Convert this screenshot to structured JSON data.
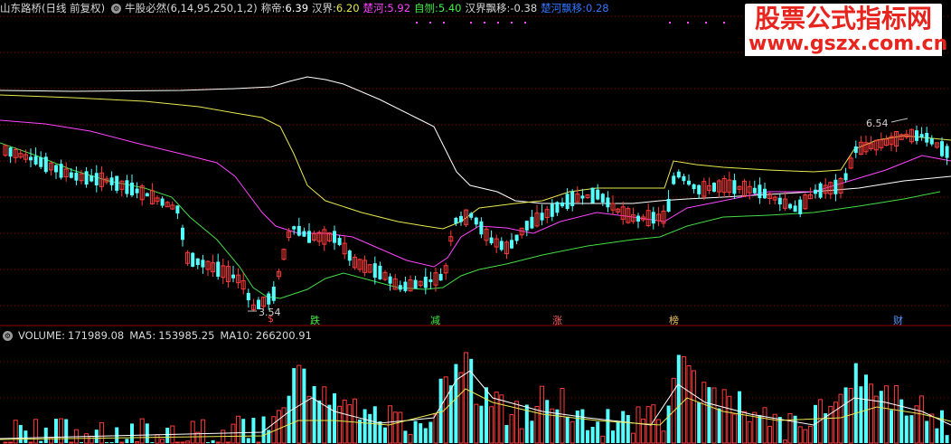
{
  "colors": {
    "up": "#ff3b3b",
    "down": "#54ffff",
    "ma_white": "#ffffff",
    "ma_yellow": "#e8e850",
    "ma_purple": "#ff44ff",
    "ma_green": "#44dd44",
    "grid": "#8b0000",
    "label_purple": "#ff44ff",
    "label_green": "#44ee44",
    "label_blue": "#3377ff"
  },
  "header": {
    "stock_name": "山东路桥(日线 前复权)",
    "indicator_name": "牛股必然(6,14,95,250,1,2)",
    "chendi_label": "称帝:",
    "chendi_value": "6.39",
    "hanjie_label": "汉界:",
    "hanjie_value": "6.20",
    "chuhe_label": "楚河:",
    "chuhe_value": "5.92",
    "zigang_label": "自刎:",
    "zigang_value": "5.40",
    "hanjie_drift_label": "汉界飘移:",
    "hanjie_drift_value": "-0.38",
    "chuhe_drift_label": "楚河飘移:",
    "chuhe_drift_value": "0.28"
  },
  "watermark": {
    "line1": "股票公式指标网",
    "line2": "www.gszx.com.cn"
  },
  "annotations": {
    "low_price": "3.54",
    "high_price": "6.54",
    "signal_1": "$",
    "signal_2": "跌",
    "signal_3": "减",
    "signal_4": "涨",
    "signal_5": "榜",
    "signal_6": "财"
  },
  "volume": {
    "label": "VOLUME:",
    "value": "171989.08",
    "ma5_label": "MA5:",
    "ma5_value": "153985.25",
    "ma10_label": "MA10:",
    "ma10_value": "266200.91"
  }
}
